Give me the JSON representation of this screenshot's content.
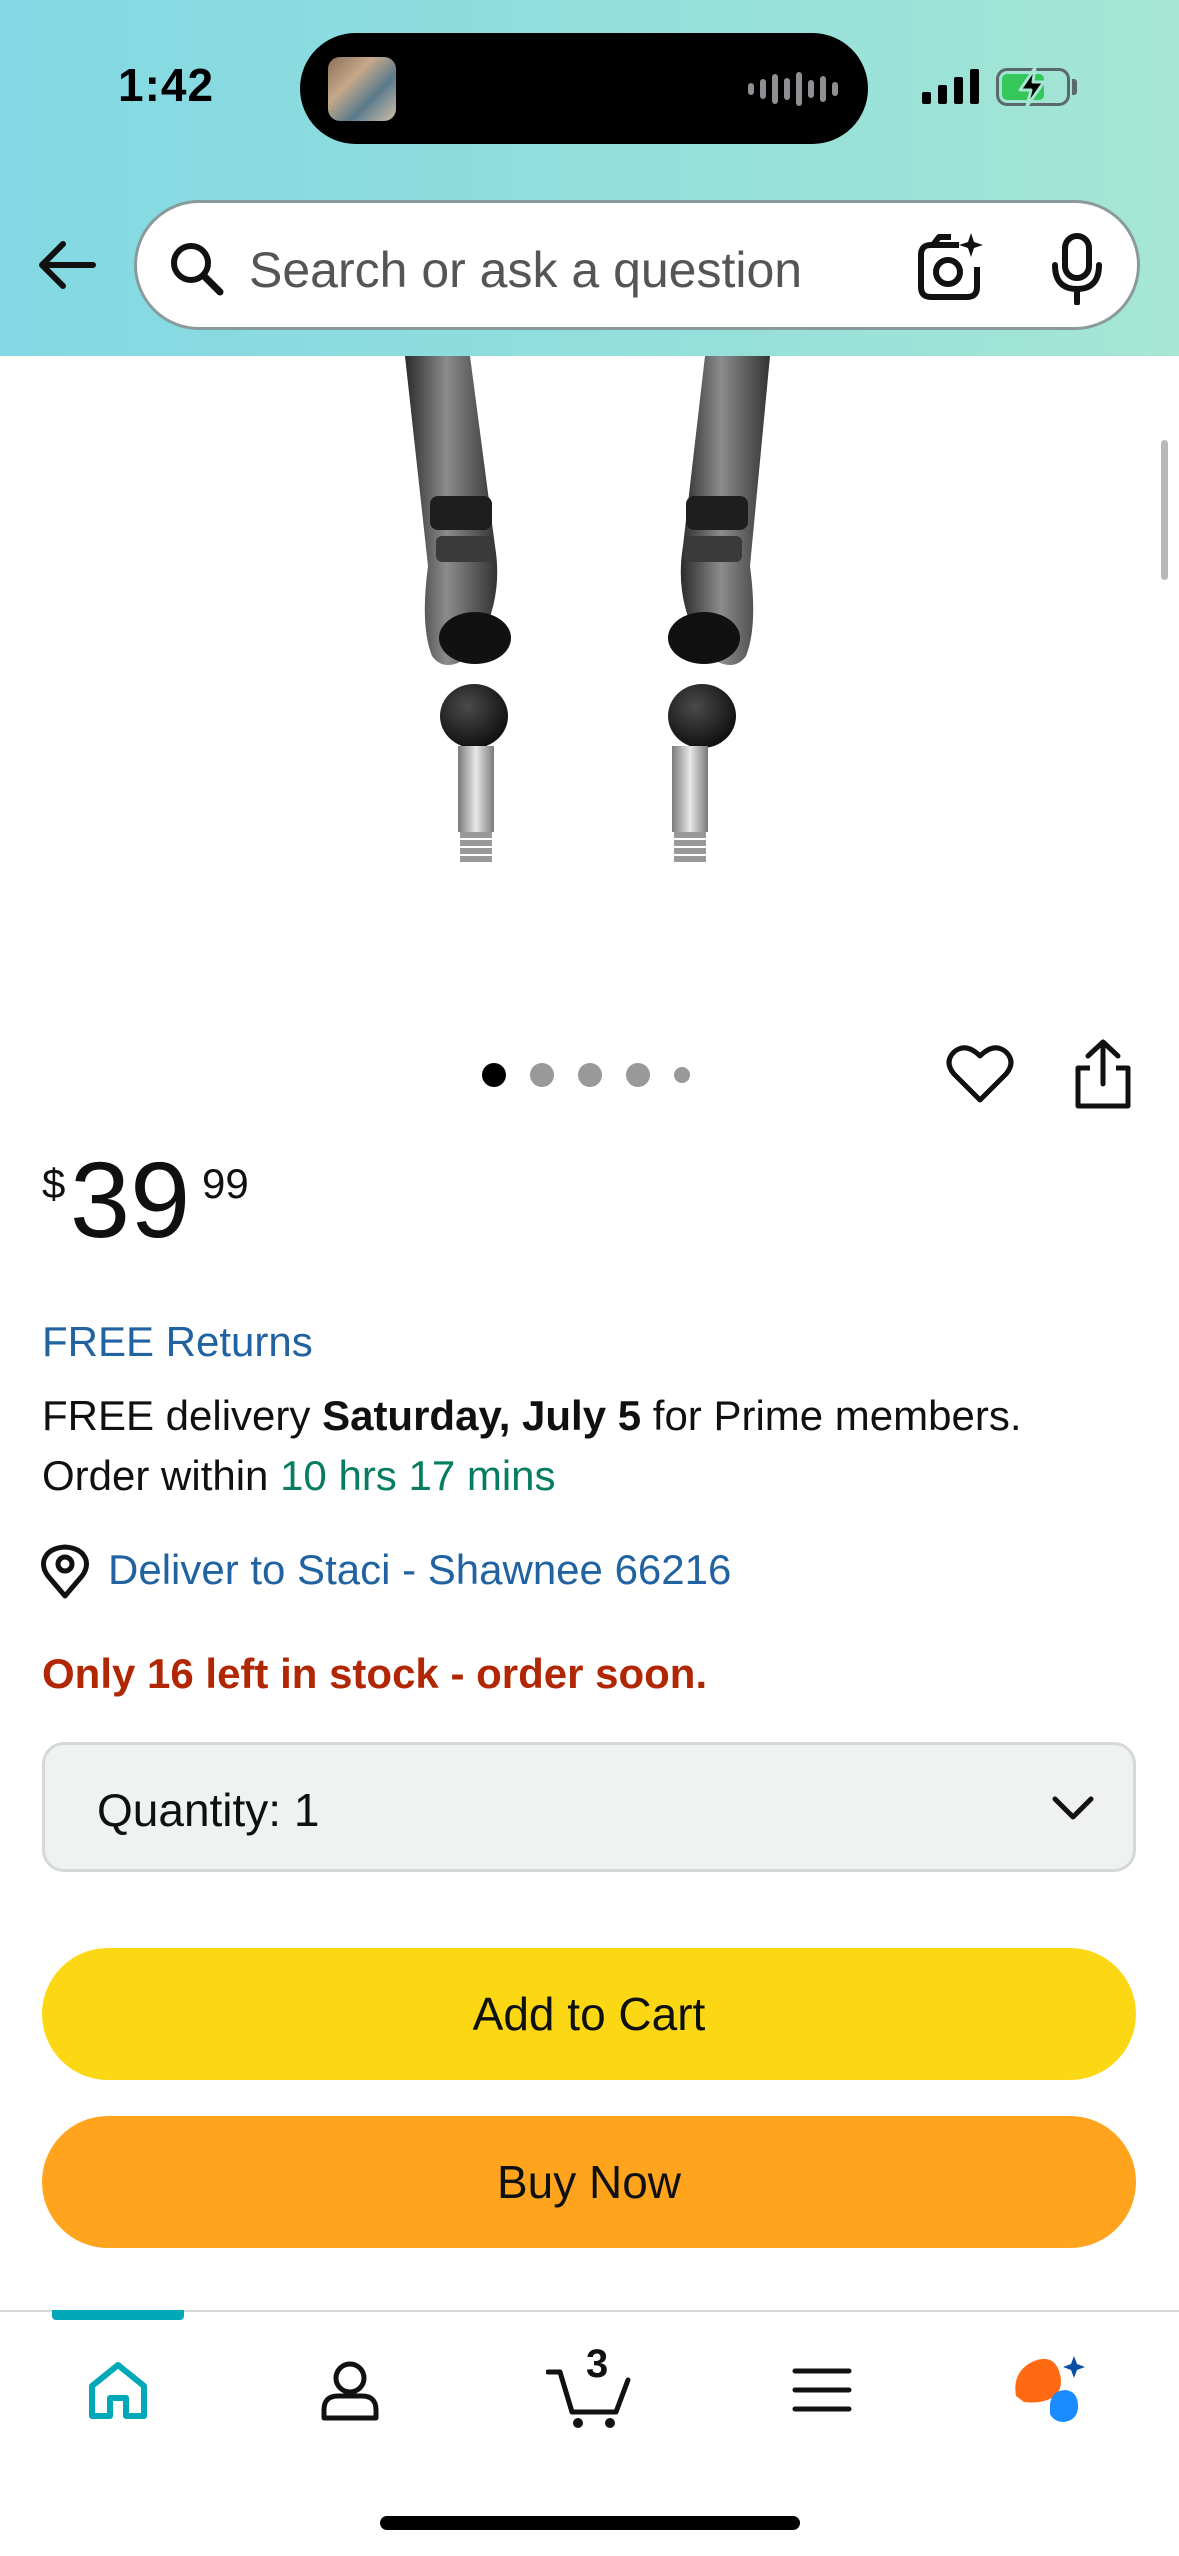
{
  "status_bar": {
    "time": "1:42"
  },
  "search": {
    "placeholder": "Search or ask a question"
  },
  "gallery": {
    "total_images": 5,
    "active_index": 0
  },
  "product": {
    "price_symbol": "$",
    "price_whole": "39",
    "price_fraction": "99",
    "free_returns": "FREE Returns",
    "delivery_prefix": "FREE delivery ",
    "delivery_date": "Saturday, July 5",
    "delivery_suffix": " for Prime members.",
    "order_within_prefix": "Order within ",
    "order_within_time": "10 hrs 17 mins",
    "deliver_to": "Deliver to Staci - Shawnee 66216",
    "stock": "Only 16 left in stock - order soon.",
    "quantity_label": "Quantity: ",
    "quantity_value": "1"
  },
  "buttons": {
    "add_to_cart": "Add to Cart",
    "buy_now": "Buy Now"
  },
  "tabbar": {
    "cart_count": "3",
    "active_tab": "home"
  },
  "colors": {
    "link": "#2162a1",
    "stock_warning": "#b12704",
    "countdown_green": "#067d62",
    "add_to_cart_bg": "#fcd814",
    "buy_now_bg": "#ffa41c",
    "active_tab": "#00a8b8"
  }
}
